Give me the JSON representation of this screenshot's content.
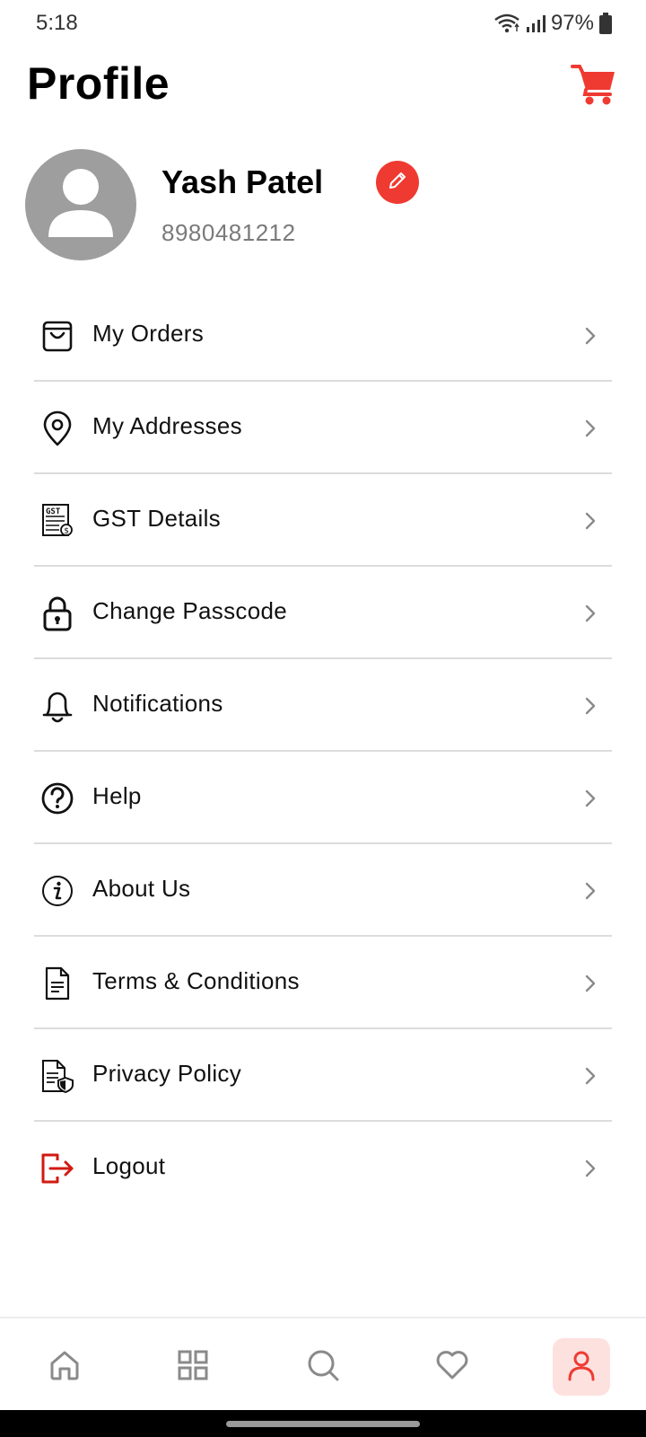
{
  "status_bar": {
    "time": "5:18",
    "battery": "97%",
    "icons": [
      "wifi-icon",
      "signal-icon",
      "battery-icon"
    ]
  },
  "header": {
    "title": "Profile",
    "cart_icon": "cart-icon"
  },
  "profile": {
    "name": "Yash Patel",
    "phone": "8980481212",
    "avatar_icon": "user-avatar-icon",
    "edit_icon": "pencil-icon"
  },
  "menu": {
    "items": [
      {
        "label": "My Orders",
        "icon": "shopping-bag-icon"
      },
      {
        "label": "My Addresses",
        "icon": "location-pin-icon"
      },
      {
        "label": "GST Details",
        "icon": "gst-document-icon"
      },
      {
        "label": "Change Passcode",
        "icon": "lock-icon"
      },
      {
        "label": "Notifications",
        "icon": "bell-icon"
      },
      {
        "label": "Help",
        "icon": "question-circle-icon"
      },
      {
        "label": "About Us",
        "icon": "info-circle-icon"
      },
      {
        "label": "Terms & Conditions",
        "icon": "document-icon"
      },
      {
        "label": "Privacy Policy",
        "icon": "privacy-document-icon"
      },
      {
        "label": "Logout",
        "icon": "logout-icon"
      }
    ]
  },
  "bottom_nav": {
    "items": [
      {
        "icon": "home-icon",
        "active": false
      },
      {
        "icon": "grid-icon",
        "active": false
      },
      {
        "icon": "search-icon",
        "active": false
      },
      {
        "icon": "heart-icon",
        "active": false
      },
      {
        "icon": "profile-icon",
        "active": true
      }
    ]
  },
  "colors": {
    "accent": "#ef3a32",
    "active_nav_bg": "#fde1df",
    "divider": "#dcdcdc",
    "secondary_text": "#7a7a7a"
  }
}
